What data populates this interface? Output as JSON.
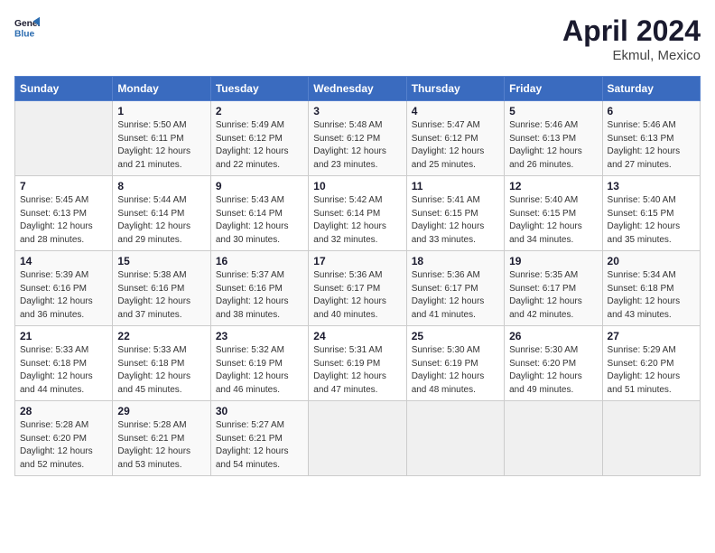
{
  "header": {
    "logo_line1": "General",
    "logo_line2": "Blue",
    "month_year": "April 2024",
    "location": "Ekmul, Mexico"
  },
  "calendar": {
    "days_of_week": [
      "Sunday",
      "Monday",
      "Tuesday",
      "Wednesday",
      "Thursday",
      "Friday",
      "Saturday"
    ],
    "weeks": [
      [
        {
          "num": "",
          "info": ""
        },
        {
          "num": "1",
          "info": "Sunrise: 5:50 AM\nSunset: 6:11 PM\nDaylight: 12 hours\nand 21 minutes."
        },
        {
          "num": "2",
          "info": "Sunrise: 5:49 AM\nSunset: 6:12 PM\nDaylight: 12 hours\nand 22 minutes."
        },
        {
          "num": "3",
          "info": "Sunrise: 5:48 AM\nSunset: 6:12 PM\nDaylight: 12 hours\nand 23 minutes."
        },
        {
          "num": "4",
          "info": "Sunrise: 5:47 AM\nSunset: 6:12 PM\nDaylight: 12 hours\nand 25 minutes."
        },
        {
          "num": "5",
          "info": "Sunrise: 5:46 AM\nSunset: 6:13 PM\nDaylight: 12 hours\nand 26 minutes."
        },
        {
          "num": "6",
          "info": "Sunrise: 5:46 AM\nSunset: 6:13 PM\nDaylight: 12 hours\nand 27 minutes."
        }
      ],
      [
        {
          "num": "7",
          "info": "Sunrise: 5:45 AM\nSunset: 6:13 PM\nDaylight: 12 hours\nand 28 minutes."
        },
        {
          "num": "8",
          "info": "Sunrise: 5:44 AM\nSunset: 6:14 PM\nDaylight: 12 hours\nand 29 minutes."
        },
        {
          "num": "9",
          "info": "Sunrise: 5:43 AM\nSunset: 6:14 PM\nDaylight: 12 hours\nand 30 minutes."
        },
        {
          "num": "10",
          "info": "Sunrise: 5:42 AM\nSunset: 6:14 PM\nDaylight: 12 hours\nand 32 minutes."
        },
        {
          "num": "11",
          "info": "Sunrise: 5:41 AM\nSunset: 6:15 PM\nDaylight: 12 hours\nand 33 minutes."
        },
        {
          "num": "12",
          "info": "Sunrise: 5:40 AM\nSunset: 6:15 PM\nDaylight: 12 hours\nand 34 minutes."
        },
        {
          "num": "13",
          "info": "Sunrise: 5:40 AM\nSunset: 6:15 PM\nDaylight: 12 hours\nand 35 minutes."
        }
      ],
      [
        {
          "num": "14",
          "info": "Sunrise: 5:39 AM\nSunset: 6:16 PM\nDaylight: 12 hours\nand 36 minutes."
        },
        {
          "num": "15",
          "info": "Sunrise: 5:38 AM\nSunset: 6:16 PM\nDaylight: 12 hours\nand 37 minutes."
        },
        {
          "num": "16",
          "info": "Sunrise: 5:37 AM\nSunset: 6:16 PM\nDaylight: 12 hours\nand 38 minutes."
        },
        {
          "num": "17",
          "info": "Sunrise: 5:36 AM\nSunset: 6:17 PM\nDaylight: 12 hours\nand 40 minutes."
        },
        {
          "num": "18",
          "info": "Sunrise: 5:36 AM\nSunset: 6:17 PM\nDaylight: 12 hours\nand 41 minutes."
        },
        {
          "num": "19",
          "info": "Sunrise: 5:35 AM\nSunset: 6:17 PM\nDaylight: 12 hours\nand 42 minutes."
        },
        {
          "num": "20",
          "info": "Sunrise: 5:34 AM\nSunset: 6:18 PM\nDaylight: 12 hours\nand 43 minutes."
        }
      ],
      [
        {
          "num": "21",
          "info": "Sunrise: 5:33 AM\nSunset: 6:18 PM\nDaylight: 12 hours\nand 44 minutes."
        },
        {
          "num": "22",
          "info": "Sunrise: 5:33 AM\nSunset: 6:18 PM\nDaylight: 12 hours\nand 45 minutes."
        },
        {
          "num": "23",
          "info": "Sunrise: 5:32 AM\nSunset: 6:19 PM\nDaylight: 12 hours\nand 46 minutes."
        },
        {
          "num": "24",
          "info": "Sunrise: 5:31 AM\nSunset: 6:19 PM\nDaylight: 12 hours\nand 47 minutes."
        },
        {
          "num": "25",
          "info": "Sunrise: 5:30 AM\nSunset: 6:19 PM\nDaylight: 12 hours\nand 48 minutes."
        },
        {
          "num": "26",
          "info": "Sunrise: 5:30 AM\nSunset: 6:20 PM\nDaylight: 12 hours\nand 49 minutes."
        },
        {
          "num": "27",
          "info": "Sunrise: 5:29 AM\nSunset: 6:20 PM\nDaylight: 12 hours\nand 51 minutes."
        }
      ],
      [
        {
          "num": "28",
          "info": "Sunrise: 5:28 AM\nSunset: 6:20 PM\nDaylight: 12 hours\nand 52 minutes."
        },
        {
          "num": "29",
          "info": "Sunrise: 5:28 AM\nSunset: 6:21 PM\nDaylight: 12 hours\nand 53 minutes."
        },
        {
          "num": "30",
          "info": "Sunrise: 5:27 AM\nSunset: 6:21 PM\nDaylight: 12 hours\nand 54 minutes."
        },
        {
          "num": "",
          "info": ""
        },
        {
          "num": "",
          "info": ""
        },
        {
          "num": "",
          "info": ""
        },
        {
          "num": "",
          "info": ""
        }
      ]
    ]
  }
}
